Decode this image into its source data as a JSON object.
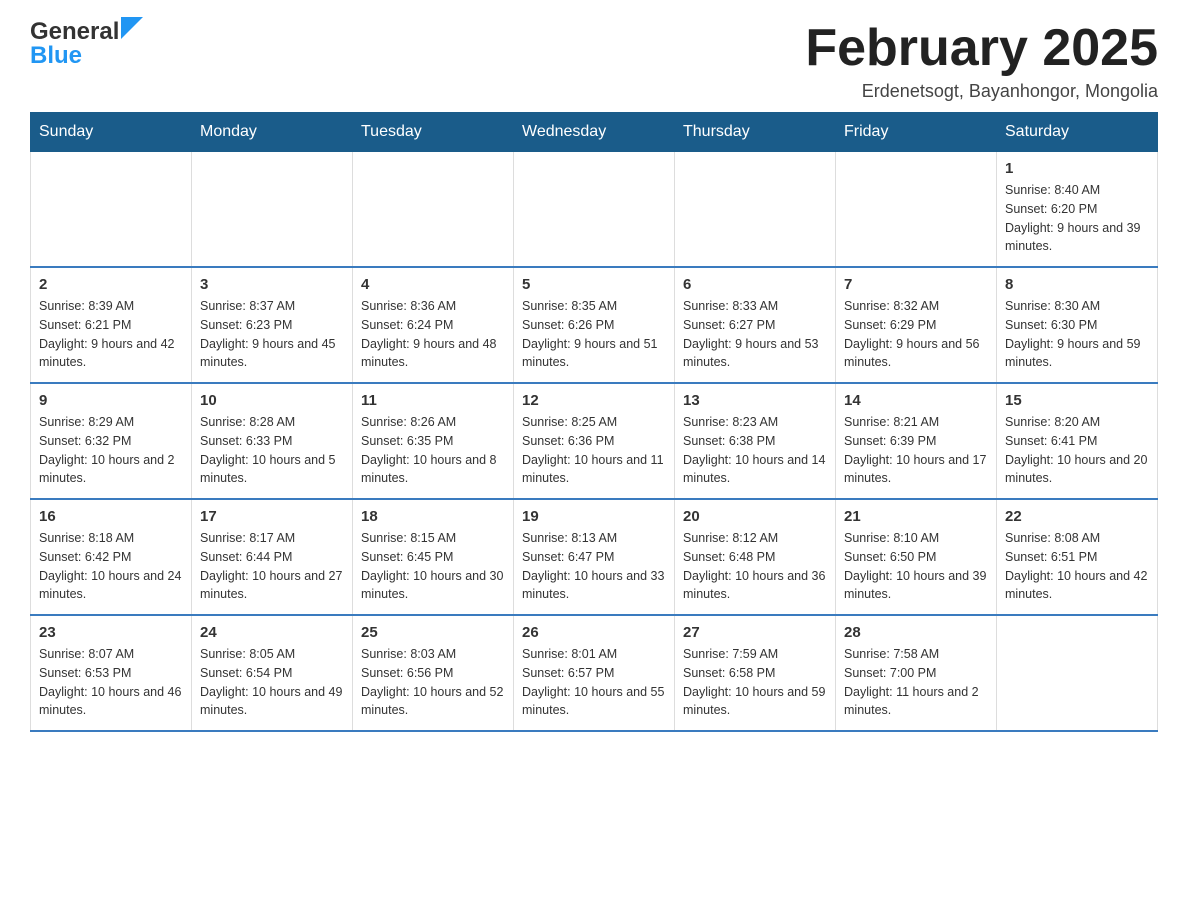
{
  "header": {
    "logo_general": "General",
    "logo_blue": "Blue",
    "month_title": "February 2025",
    "location": "Erdenetsogt, Bayanhongor, Mongolia"
  },
  "weekdays": [
    "Sunday",
    "Monday",
    "Tuesday",
    "Wednesday",
    "Thursday",
    "Friday",
    "Saturday"
  ],
  "weeks": [
    [
      {
        "day": "",
        "info": ""
      },
      {
        "day": "",
        "info": ""
      },
      {
        "day": "",
        "info": ""
      },
      {
        "day": "",
        "info": ""
      },
      {
        "day": "",
        "info": ""
      },
      {
        "day": "",
        "info": ""
      },
      {
        "day": "1",
        "info": "Sunrise: 8:40 AM\nSunset: 6:20 PM\nDaylight: 9 hours and 39 minutes."
      }
    ],
    [
      {
        "day": "2",
        "info": "Sunrise: 8:39 AM\nSunset: 6:21 PM\nDaylight: 9 hours and 42 minutes."
      },
      {
        "day": "3",
        "info": "Sunrise: 8:37 AM\nSunset: 6:23 PM\nDaylight: 9 hours and 45 minutes."
      },
      {
        "day": "4",
        "info": "Sunrise: 8:36 AM\nSunset: 6:24 PM\nDaylight: 9 hours and 48 minutes."
      },
      {
        "day": "5",
        "info": "Sunrise: 8:35 AM\nSunset: 6:26 PM\nDaylight: 9 hours and 51 minutes."
      },
      {
        "day": "6",
        "info": "Sunrise: 8:33 AM\nSunset: 6:27 PM\nDaylight: 9 hours and 53 minutes."
      },
      {
        "day": "7",
        "info": "Sunrise: 8:32 AM\nSunset: 6:29 PM\nDaylight: 9 hours and 56 minutes."
      },
      {
        "day": "8",
        "info": "Sunrise: 8:30 AM\nSunset: 6:30 PM\nDaylight: 9 hours and 59 minutes."
      }
    ],
    [
      {
        "day": "9",
        "info": "Sunrise: 8:29 AM\nSunset: 6:32 PM\nDaylight: 10 hours and 2 minutes."
      },
      {
        "day": "10",
        "info": "Sunrise: 8:28 AM\nSunset: 6:33 PM\nDaylight: 10 hours and 5 minutes."
      },
      {
        "day": "11",
        "info": "Sunrise: 8:26 AM\nSunset: 6:35 PM\nDaylight: 10 hours and 8 minutes."
      },
      {
        "day": "12",
        "info": "Sunrise: 8:25 AM\nSunset: 6:36 PM\nDaylight: 10 hours and 11 minutes."
      },
      {
        "day": "13",
        "info": "Sunrise: 8:23 AM\nSunset: 6:38 PM\nDaylight: 10 hours and 14 minutes."
      },
      {
        "day": "14",
        "info": "Sunrise: 8:21 AM\nSunset: 6:39 PM\nDaylight: 10 hours and 17 minutes."
      },
      {
        "day": "15",
        "info": "Sunrise: 8:20 AM\nSunset: 6:41 PM\nDaylight: 10 hours and 20 minutes."
      }
    ],
    [
      {
        "day": "16",
        "info": "Sunrise: 8:18 AM\nSunset: 6:42 PM\nDaylight: 10 hours and 24 minutes."
      },
      {
        "day": "17",
        "info": "Sunrise: 8:17 AM\nSunset: 6:44 PM\nDaylight: 10 hours and 27 minutes."
      },
      {
        "day": "18",
        "info": "Sunrise: 8:15 AM\nSunset: 6:45 PM\nDaylight: 10 hours and 30 minutes."
      },
      {
        "day": "19",
        "info": "Sunrise: 8:13 AM\nSunset: 6:47 PM\nDaylight: 10 hours and 33 minutes."
      },
      {
        "day": "20",
        "info": "Sunrise: 8:12 AM\nSunset: 6:48 PM\nDaylight: 10 hours and 36 minutes."
      },
      {
        "day": "21",
        "info": "Sunrise: 8:10 AM\nSunset: 6:50 PM\nDaylight: 10 hours and 39 minutes."
      },
      {
        "day": "22",
        "info": "Sunrise: 8:08 AM\nSunset: 6:51 PM\nDaylight: 10 hours and 42 minutes."
      }
    ],
    [
      {
        "day": "23",
        "info": "Sunrise: 8:07 AM\nSunset: 6:53 PM\nDaylight: 10 hours and 46 minutes."
      },
      {
        "day": "24",
        "info": "Sunrise: 8:05 AM\nSunset: 6:54 PM\nDaylight: 10 hours and 49 minutes."
      },
      {
        "day": "25",
        "info": "Sunrise: 8:03 AM\nSunset: 6:56 PM\nDaylight: 10 hours and 52 minutes."
      },
      {
        "day": "26",
        "info": "Sunrise: 8:01 AM\nSunset: 6:57 PM\nDaylight: 10 hours and 55 minutes."
      },
      {
        "day": "27",
        "info": "Sunrise: 7:59 AM\nSunset: 6:58 PM\nDaylight: 10 hours and 59 minutes."
      },
      {
        "day": "28",
        "info": "Sunrise: 7:58 AM\nSunset: 7:00 PM\nDaylight: 11 hours and 2 minutes."
      },
      {
        "day": "",
        "info": ""
      }
    ]
  ]
}
